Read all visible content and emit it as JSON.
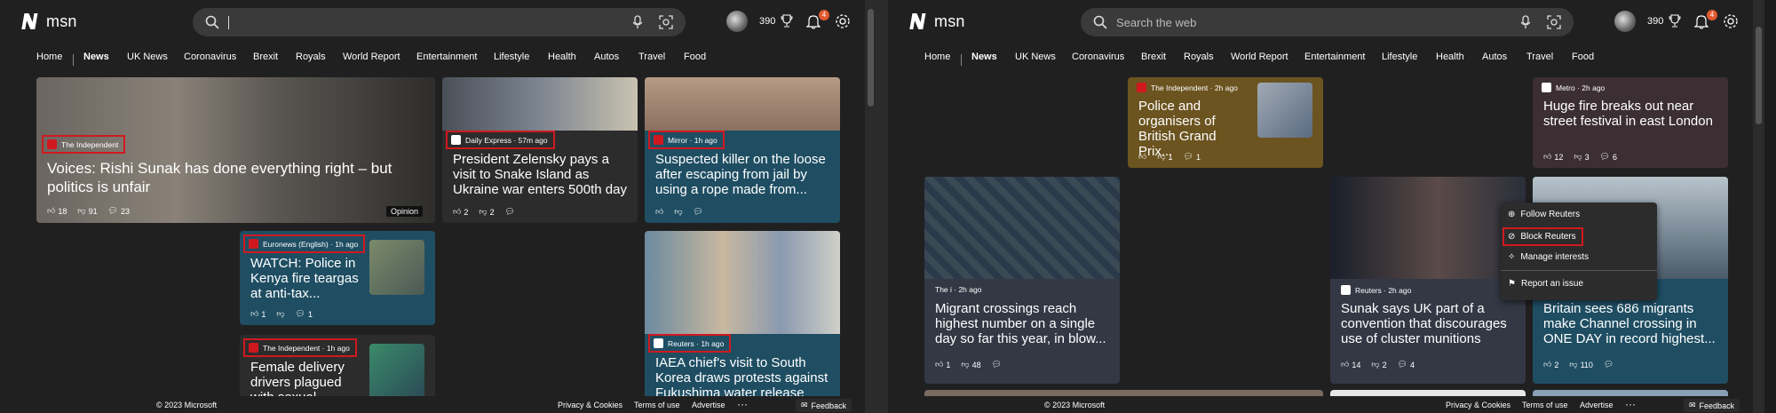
{
  "app": {
    "logo_text": "msn"
  },
  "search": {
    "placeholder_left": "",
    "placeholder_right": "Search the web"
  },
  "user": {
    "points": "390",
    "notifications": "4"
  },
  "nav": {
    "items": [
      "Home",
      "News",
      "UK News",
      "Coronavirus",
      "Brexit",
      "Royals",
      "World Report",
      "Entertainment",
      "Lifestyle",
      "Health",
      "Autos",
      "Travel",
      "Food"
    ],
    "active": "News"
  },
  "footer": {
    "copyright": "© 2023 Microsoft",
    "privacy": "Privacy & Cookies",
    "terms": "Terms of use",
    "advertise": "Advertise",
    "more": "···",
    "feedback": "Feedback"
  },
  "left": {
    "cards": [
      {
        "source": "The Independent",
        "title": "Voices: Rishi Sunak has done everything right – but politics is unfair",
        "likes": "18",
        "dislikes": "91",
        "comments": "23",
        "tag": "Opinion"
      },
      {
        "source": "Daily Express · 57m ago",
        "title": "President Zelensky pays a visit to Snake Island as Ukraine war enters 500th day",
        "likes": "2",
        "dislikes": "2"
      },
      {
        "source": "Mirror · 1h ago",
        "title": "Suspected killer on the loose after escaping from jail by using a rope made from..."
      },
      {
        "source": "Euronews (English) · 1h ago",
        "title": "WATCH: Police in Kenya fire teargas at anti-tax...",
        "likes": "1",
        "comments": "1"
      },
      {
        "source": "The Independent · 1h ago",
        "title": "Female delivery drivers plagued with sexual..."
      },
      {
        "source": "Reuters · 1h ago",
        "title": "IAEA chief's visit to South Korea draws protests against Fukushima water release"
      }
    ]
  },
  "right": {
    "cards": [
      {
        "source": "The Independent · 2h ago",
        "title": "Police and organisers of British Grand Prix...",
        "likes": "",
        "dislikes": "1",
        "comments": "1"
      },
      {
        "source": "Metro · 2h ago",
        "title": "Huge fire breaks out near street festival in east London",
        "likes": "12",
        "dislikes": "3",
        "comments": "6"
      },
      {
        "source": "The i · 2h ago",
        "title": "Migrant crossings reach highest number on a single day so far this year, in blow...",
        "likes": "1",
        "dislikes": "48"
      },
      {
        "source": "Reuters · 2h ago",
        "title": "Sunak says UK part of a convention that discourages use of cluster munitions",
        "likes": "14",
        "dislikes": "2",
        "comments": "4"
      },
      {
        "source": "",
        "title": "Britain sees 686 migrants make Channel crossing in ONE DAY in record highest...",
        "likes": "2",
        "dislikes": "110"
      }
    ],
    "menu": {
      "follow": "Follow Reuters",
      "block": "Block Reuters",
      "manage": "Manage interests",
      "report": "Report an issue"
    }
  },
  "colors": {
    "highlight": "#d0191f",
    "teal_card": "#1f4e63",
    "brown_card": "#6b5420",
    "mauve_card": "#3c2f33",
    "slate_card": "#333844"
  }
}
